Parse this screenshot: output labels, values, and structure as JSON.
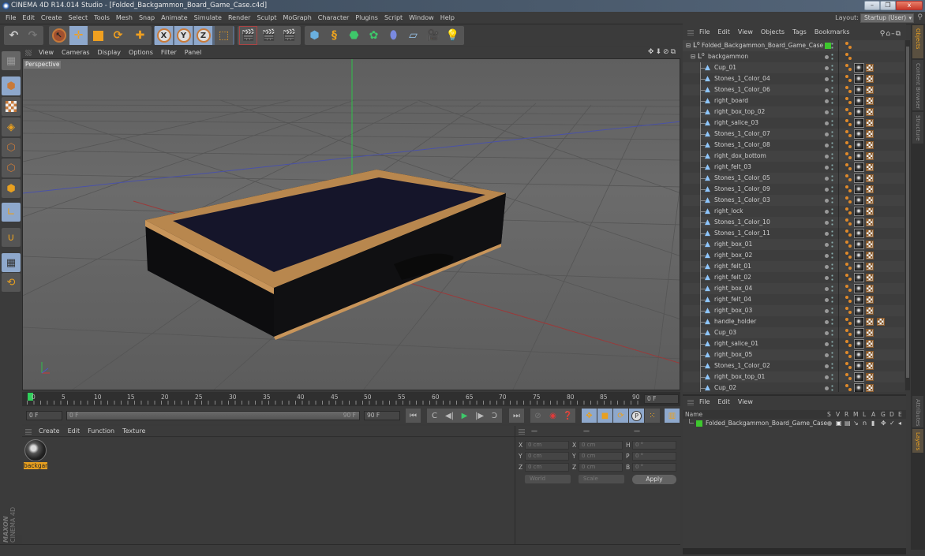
{
  "window": {
    "title": "CINEMA 4D R14.014 Studio - [Folded_Backgammon_Board_Game_Case.c4d]",
    "minimize_icon": "minimize-icon",
    "restore_icon": "restore-icon",
    "close_label": "x"
  },
  "menubar": {
    "items": [
      "File",
      "Edit",
      "Create",
      "Select",
      "Tools",
      "Mesh",
      "Snap",
      "Animate",
      "Simulate",
      "Render",
      "Sculpt",
      "MoGraph",
      "Character",
      "Plugins",
      "Script",
      "Window",
      "Help"
    ],
    "layout_label": "Layout:",
    "layout_value": "Startup (User)"
  },
  "toolbar": {
    "groups": [
      [
        "undo-icon",
        "redo-icon"
      ],
      [
        "live-selection-icon",
        "move-icon",
        "scale-icon",
        "rotate-icon",
        "add-object-icon"
      ],
      [
        "x-axis-lock-icon",
        "y-axis-lock-icon",
        "z-axis-lock-icon",
        "world-coordinate-icon"
      ],
      [
        "render-view-icon",
        "render-picture-viewer-icon",
        "render-settings-icon"
      ],
      [
        "cube-object-icon",
        "spline-pen-icon",
        "nurbs-icon",
        "array-icon",
        "deformer-icon",
        "floor-scene-icon",
        "camera-icon",
        "light-icon"
      ]
    ],
    "axis_labels": [
      "X",
      "Y",
      "Z"
    ]
  },
  "left_tools": [
    "make-editable-icon",
    "model-mode-icon",
    "texture-mode-icon",
    "workplane-icon",
    "points-mode-icon",
    "edges-mode-icon",
    "polygons-mode-icon",
    "axis-mode-icon",
    "snap-icon",
    "locked-workplane-icon",
    "planar-workplane-icon"
  ],
  "branding": {
    "maxon": "MAXON",
    "product": "CINEMA 4D"
  },
  "viewport": {
    "menu": [
      "View",
      "Cameras",
      "Display",
      "Options",
      "Filter",
      "Panel"
    ],
    "nav_icons": [
      "move-view-icon",
      "zoom-view-icon",
      "rotate-view-icon",
      "maximize-view-icon"
    ],
    "label": "Perspective"
  },
  "timeline": {
    "ticks": [
      "0",
      "5",
      "10",
      "15",
      "20",
      "25",
      "30",
      "35",
      "40",
      "45",
      "50",
      "55",
      "60",
      "65",
      "70",
      "75",
      "80",
      "85",
      "90"
    ],
    "current_frame": "0 F",
    "start_field": "0 F",
    "range_start": "0 F",
    "range_end": "90 F",
    "end_field": "90 F"
  },
  "transport": {
    "buttons": [
      "go-to-start-icon",
      "previous-key-icon",
      "step-back-icon",
      "play-icon",
      "step-forward-icon",
      "next-key-icon",
      "go-to-end-icon"
    ],
    "record_buttons": [
      "record-disabled-icon",
      "record-active-objects-icon",
      "autokey-icon"
    ],
    "key_buttons": [
      "key-position-icon",
      "key-scale-icon",
      "key-rotation-icon",
      "key-parameter-icon",
      "key-point-level-icon"
    ],
    "timeline_button": "timeline-window-icon",
    "param_label": "P"
  },
  "material_manager": {
    "menu": [
      "Create",
      "Edit",
      "Function",
      "Texture"
    ],
    "materials": [
      {
        "name": "backgar"
      }
    ]
  },
  "coordinates": {
    "headers": [
      "—",
      "—",
      "—"
    ],
    "rows": [
      {
        "l1": "X",
        "v1": "0 cm",
        "l2": "X",
        "v2": "0 cm",
        "l3": "H",
        "v3": "0 °"
      },
      {
        "l1": "Y",
        "v1": "0 cm",
        "l2": "Y",
        "v2": "0 cm",
        "l3": "P",
        "v3": "0 °"
      },
      {
        "l1": "Z",
        "v1": "0 cm",
        "l2": "Z",
        "v2": "0 cm",
        "l3": "B",
        "v3": "0 °"
      }
    ],
    "mode_select": "World",
    "size_select": "Scale",
    "apply_label": "Apply"
  },
  "object_manager": {
    "menu": [
      "File",
      "Edit",
      "View",
      "Objects",
      "Tags",
      "Bookmarks"
    ],
    "tool_icons": [
      "search-icon",
      "home-icon",
      "minus-icon",
      "new-window-icon"
    ],
    "root": {
      "name": "Folded_Backgammon_Board_Game_Case",
      "layer_color": "#3ec82e"
    },
    "group": {
      "name": "backgammon"
    },
    "objects": [
      {
        "name": "Cup_01"
      },
      {
        "name": "Stones_1_Color_04"
      },
      {
        "name": "Stones_1_Color_06"
      },
      {
        "name": "right_board"
      },
      {
        "name": "right_box_top_02"
      },
      {
        "name": "right_salice_03"
      },
      {
        "name": "Stones_1_Color_07"
      },
      {
        "name": "Stones_1_Color_08"
      },
      {
        "name": "right_dox_bottom"
      },
      {
        "name": "right_felt_03"
      },
      {
        "name": "Stones_1_Color_05"
      },
      {
        "name": "Stones_1_Color_09"
      },
      {
        "name": "Stones_1_Color_03"
      },
      {
        "name": "right_lock"
      },
      {
        "name": "Stones_1_Color_10"
      },
      {
        "name": "Stones_1_Color_11"
      },
      {
        "name": "right_box_01"
      },
      {
        "name": "right_box_02"
      },
      {
        "name": "right_felt_01"
      },
      {
        "name": "right_felt_02"
      },
      {
        "name": "right_box_04"
      },
      {
        "name": "right_felt_04"
      },
      {
        "name": "right_box_03"
      },
      {
        "name": "handle_holder",
        "extra_tag": true
      },
      {
        "name": "Cup_03"
      },
      {
        "name": "right_salice_01"
      },
      {
        "name": "right_box_05"
      },
      {
        "name": "Stones_1_Color_02"
      },
      {
        "name": "right_box_top_01"
      },
      {
        "name": "Cup_02"
      }
    ]
  },
  "right_tabs": {
    "top": [
      {
        "label": "Objects",
        "active": true
      },
      {
        "label": "Content Browser",
        "active": false
      },
      {
        "label": "Structure",
        "active": false
      }
    ],
    "bottom": [
      {
        "label": "Attributes",
        "active": false
      },
      {
        "label": "Layers",
        "active": true
      }
    ]
  },
  "layer_manager": {
    "menu": [
      "File",
      "Edit",
      "View"
    ],
    "columns": {
      "name": "Name",
      "flags": [
        "S",
        "V",
        "R",
        "M",
        "L",
        "A",
        "G",
        "D",
        "E"
      ]
    },
    "layers": [
      {
        "name": "Folded_Backgammon_Board_Game_Case",
        "color": "#3ec82e"
      }
    ]
  },
  "colors": {
    "accent_orange": "#e8a020",
    "selection_blue": "#8ea8cc",
    "axis_x": "#c83a3a",
    "axis_y": "#2fc24a",
    "axis_z": "#4a5acc",
    "current_frame": "#2fd05a"
  }
}
